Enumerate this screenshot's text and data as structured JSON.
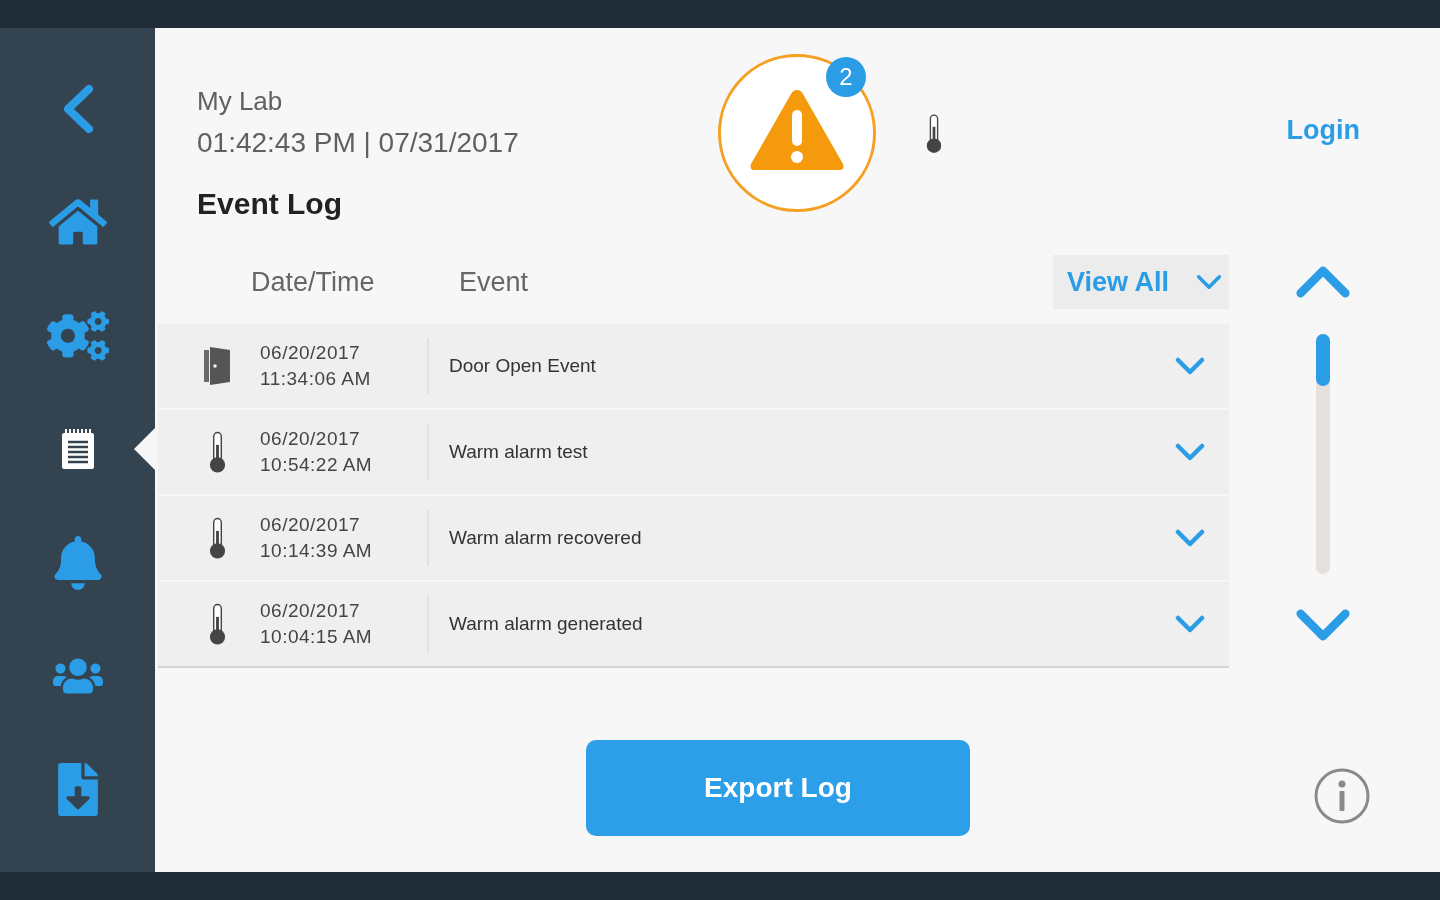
{
  "sidebar": {
    "items": [
      {
        "selected": false
      },
      {
        "selected": false
      },
      {
        "selected": true
      },
      {
        "selected": false
      },
      {
        "selected": false
      },
      {
        "selected": false
      }
    ]
  },
  "header": {
    "location": "My Lab",
    "datetime": "01:42:43 PM | 07/31/2017",
    "title": "Event Log",
    "alert_count": "2",
    "login": "Login"
  },
  "event_log": {
    "columns": [
      "Date/Time",
      "Event"
    ],
    "filter": "View All",
    "rows": [
      {
        "kind": "door",
        "date": "06/20/2017",
        "time": "11:34:06 AM",
        "event": "Door Open Event",
        "expanded": false
      },
      {
        "kind": "temperature",
        "date": "06/20/2017",
        "time": "10:54:22 AM",
        "event": "Warm alarm test",
        "expanded": false
      },
      {
        "kind": "temperature",
        "date": "06/20/2017",
        "time": "10:14:39 AM",
        "event": "Warm alarm recovered",
        "expanded": false
      },
      {
        "kind": "temperature",
        "date": "06/20/2017",
        "time": "10:04:15 AM",
        "event": "Warm alarm generated",
        "expanded": false
      }
    ]
  },
  "export_button": "Export Log"
}
